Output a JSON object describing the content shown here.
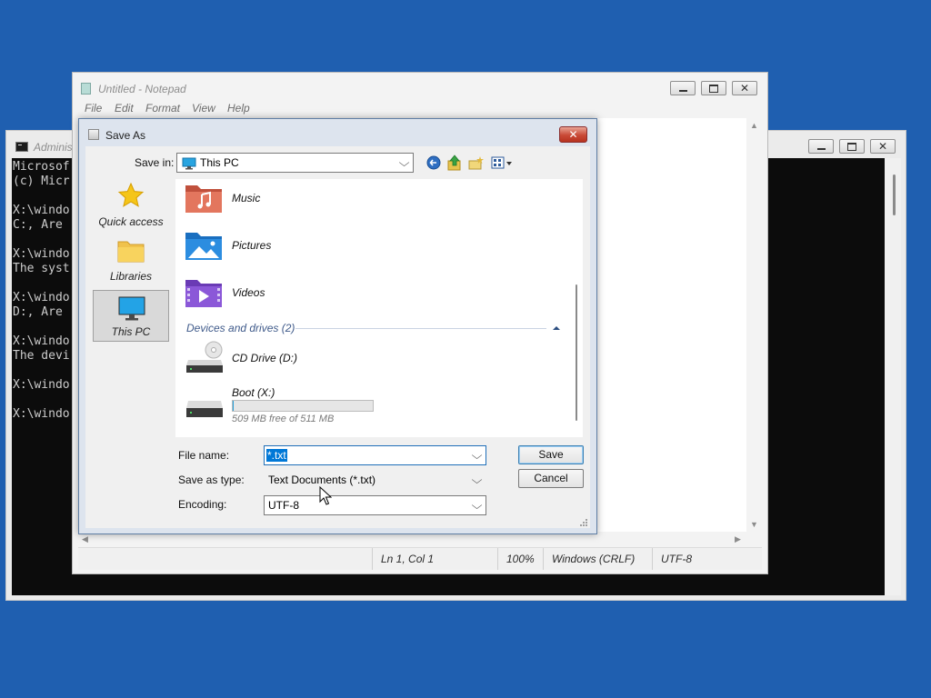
{
  "console": {
    "title": "Adminis",
    "lines": [
      "Microsof",
      "(c) Micr",
      "",
      "X:\\windo",
      "C:, Are",
      "",
      "X:\\windo",
      "The syst",
      "",
      "X:\\windo",
      "D:, Are",
      "",
      "X:\\windo",
      "The devi",
      "",
      "X:\\windo",
      "",
      "X:\\windo"
    ]
  },
  "notepad": {
    "title": "Untitled - Notepad",
    "menu": [
      "File",
      "Edit",
      "Format",
      "View",
      "Help"
    ],
    "status": {
      "position": "Ln 1, Col 1",
      "zoom": "100%",
      "line_ending": "Windows (CRLF)",
      "encoding": "UTF-8"
    }
  },
  "dialog": {
    "title": "Save As",
    "close_glyph": "✕",
    "save_in_label": "Save in:",
    "save_in_value": "This PC",
    "places": [
      {
        "label": "Quick access",
        "icon": "star-icon"
      },
      {
        "label": "Libraries",
        "icon": "folder-icon"
      },
      {
        "label": "This PC",
        "icon": "monitor-icon",
        "selected": true
      }
    ],
    "folders": [
      {
        "label": "Music",
        "icon": "music-folder-icon"
      },
      {
        "label": "Pictures",
        "icon": "pictures-folder-icon"
      },
      {
        "label": "Videos",
        "icon": "videos-folder-icon"
      }
    ],
    "devices_header": "Devices and drives (2)",
    "drives": [
      {
        "label": "CD Drive (D:)",
        "icon": "cd-drive-icon"
      },
      {
        "label": "Boot (X:)",
        "icon": "hard-drive-icon",
        "free_text": "509 MB free of 511 MB",
        "used_fraction": 0.004
      }
    ],
    "file_name_label": "File name:",
    "file_name_value": "*.txt",
    "save_type_label": "Save as type:",
    "save_type_value": "Text Documents (*.txt)",
    "encoding_label": "Encoding:",
    "encoding_value": "UTF-8",
    "save_button": "Save",
    "cancel_button": "Cancel"
  },
  "colors": {
    "desktop": "#1f5fb0",
    "console_bg": "#0c0c0c",
    "selection": "#0078d7",
    "close_red": "#c94a36"
  }
}
